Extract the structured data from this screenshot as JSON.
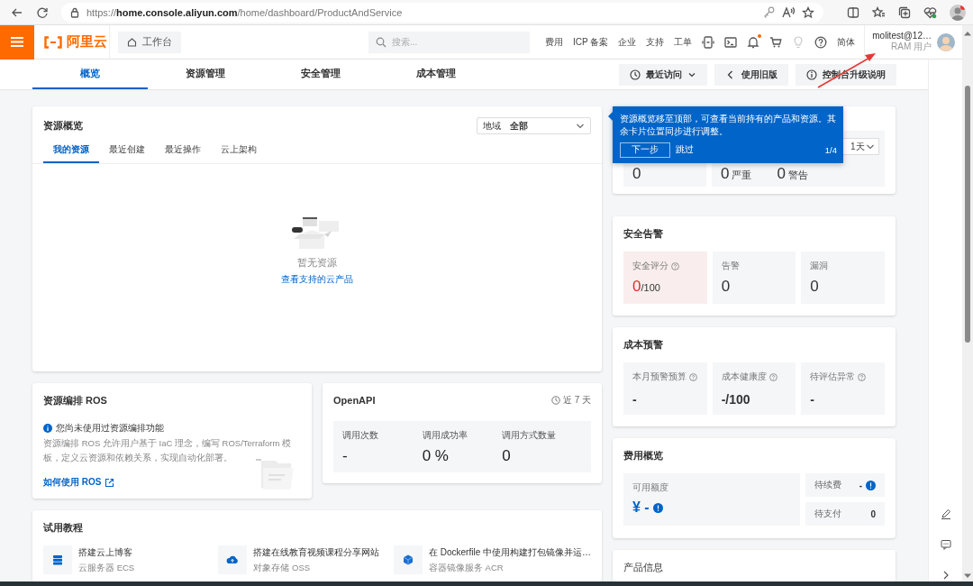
{
  "browser": {
    "url": "https://**home.console.aliyun.com**/home/dashboard/ProductAndService"
  },
  "header": {
    "logo": "阿里云",
    "workbench": "工作台",
    "search_placeholder": "搜索...",
    "links": [
      "费用",
      "ICP 备案",
      "企业",
      "支持",
      "工单"
    ],
    "icons": [
      {
        "kind": "device",
        "badge": false,
        "disabled": false
      },
      {
        "kind": "terminal",
        "badge": false,
        "disabled": false
      },
      {
        "kind": "bell",
        "badge": true,
        "disabled": false
      },
      {
        "kind": "cart",
        "badge": false,
        "disabled": false
      },
      {
        "kind": "bulb",
        "badge": false,
        "disabled": true
      },
      {
        "kind": "help",
        "badge": false,
        "disabled": false
      }
    ],
    "language": "简体",
    "user": {
      "name": "molitest@12…",
      "role": "RAM 用户"
    }
  },
  "tabs": [
    {
      "label": "概览",
      "selected": true
    },
    {
      "label": "资源管理",
      "selected": false
    },
    {
      "label": "安全管理",
      "selected": false
    },
    {
      "label": "成本管理",
      "selected": false
    }
  ],
  "tab_actions": [
    {
      "kind": "recent",
      "label": "最近访问"
    },
    {
      "kind": "legacy",
      "label": "使用旧版"
    },
    {
      "kind": "info",
      "label": "控制台升级说明"
    }
  ],
  "resource_overview": {
    "title": "资源概览",
    "region_label": "地域",
    "region_value": "全部",
    "tabs": [
      {
        "label": "我的资源",
        "selected": true
      },
      {
        "label": "最近创建",
        "selected": false
      },
      {
        "label": "最近操作",
        "selected": false
      },
      {
        "label": "云上架构",
        "selected": false
      }
    ],
    "empty_text": "暂无资源",
    "link": "查看支持的云产品"
  },
  "ros": {
    "title": "资源编排 ROS",
    "notice": "您尚未使用过资源编排功能",
    "description": "资源编排 ROS 允许用户基于 IaC 理念，编写 ROS/Terraform 模板，定义云资源和依赖关系，实现自动化部署。",
    "link": "如何使用 ROS"
  },
  "openapi": {
    "title": "OpenAPI",
    "period": "近 7 天",
    "metrics": [
      {
        "label": "调用次数",
        "value": "-"
      },
      {
        "label": "调用成功率",
        "value": "0 %"
      },
      {
        "label": "调用方式数量",
        "value": "0"
      }
    ]
  },
  "tutorials": {
    "title": "试用教程",
    "items": [
      {
        "kind": "server",
        "title": "搭建云上博客",
        "product": "云服务器 ECS"
      },
      {
        "kind": "cloud",
        "title": "搭建在线教育视频课程分享网站",
        "product": "对象存储 OSS"
      },
      {
        "kind": "cube",
        "title": "在 Dockerfile 中使用构建打包镜像并运…",
        "product": "容器镜像服务 ACR"
      }
    ]
  },
  "events": {
    "first_value": "0",
    "levels": [
      {
        "value": "0",
        "label": "严重"
      },
      {
        "value": "0",
        "label": "警告"
      }
    ],
    "period": "1天"
  },
  "security": {
    "title": "安全告警",
    "metrics": [
      {
        "label": "安全评分",
        "help": true,
        "alert": true,
        "value": "0",
        "suffix": "/100"
      },
      {
        "label": "告警",
        "help": false,
        "alert": false,
        "value": "0"
      },
      {
        "label": "漏洞",
        "help": false,
        "alert": false,
        "value": "0"
      }
    ]
  },
  "cost_alert": {
    "title": "成本预警",
    "metrics": [
      {
        "label": "本月预警预算",
        "help": true,
        "value": "-"
      },
      {
        "label": "成本健康度",
        "help": true,
        "value": "-/100"
      },
      {
        "label": "待评估异常",
        "help": true,
        "value": "-"
      }
    ]
  },
  "billing": {
    "title": "费用概览",
    "available": {
      "label": "可用额度",
      "value": "¥ -",
      "info": true
    },
    "items": [
      {
        "label": "待续费",
        "value": "-",
        "info": true
      },
      {
        "label": "待支付",
        "value": "0",
        "info": false
      }
    ]
  },
  "product_info": {
    "title": "产品信息"
  },
  "guide": {
    "text": "资源概览移至顶部，可查看当前持有的产品和资源。其余卡片位置同步进行调整。",
    "next": "下一步",
    "skip": "跳过",
    "step": "1/4"
  }
}
